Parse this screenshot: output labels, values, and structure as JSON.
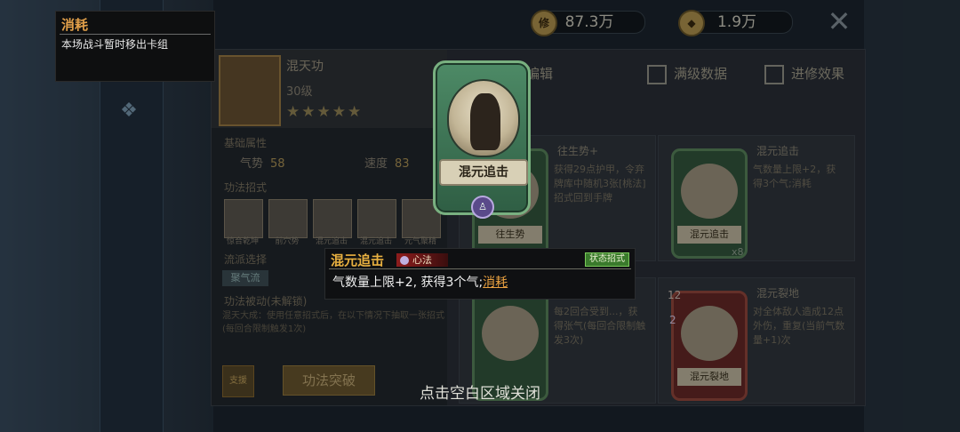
{
  "top": {
    "currency1": {
      "icon": "修",
      "value": "87.3万"
    },
    "currency2": {
      "icon": "◆",
      "value": "1.9万"
    }
  },
  "tooltip": {
    "title": "消耗",
    "text": "本场战斗暂时移出卡组"
  },
  "skill": {
    "name": "混天功",
    "level": "30级",
    "stars": "★★★★★",
    "base_attr_label": "基础属性",
    "stat1": {
      "label": "气势",
      "value": "58"
    },
    "stat2": {
      "label": "速度",
      "value": "83"
    },
    "moves_label": "功法招式",
    "moves": [
      "惊合乾坤",
      "前穴势",
      "混元追击",
      "混元追击",
      "元气聚精"
    ],
    "flow_label": "流派选择",
    "flow_button": "聚气流",
    "passive_label": "功法被动(未解锁)",
    "passive_text": "混天大成：使用任意招式后，在以下情况下抽取一张招式(每回合限制触发1次)",
    "break_button": "功法突破",
    "side_button": "支援"
  },
  "filters": {
    "tab_partial": "编辑",
    "max_data": "满级数据",
    "advance_effect": "进修效果"
  },
  "cells": [
    {
      "title": "往生势+",
      "desc": "获得29点护甲，令弃牌库中随机3张[桃法]招式回到手牌",
      "card": "往生势"
    },
    {
      "title": "混元追击",
      "desc": "气数量上限+2，获得3个气;消耗",
      "card": "混元追击",
      "count": "x8"
    },
    {
      "title": "",
      "desc": "每2回合受到...，获得张气(每回合限制触发3次)",
      "card": ""
    },
    {
      "title": "混元裂地",
      "desc": "对全体敌人造成12点外伤，重复(当前气数量+1)次",
      "card": "混元裂地",
      "cost": "2",
      "top_cost": "12"
    }
  ],
  "big_card": {
    "name": "混元追击"
  },
  "detail": {
    "name": "混元追击",
    "type": "心法",
    "tag": "状态招式",
    "text_main": "气数量上限+2, 获得3个气;",
    "text_keyword": "消耗"
  },
  "hint": "点击空白区域关闭"
}
